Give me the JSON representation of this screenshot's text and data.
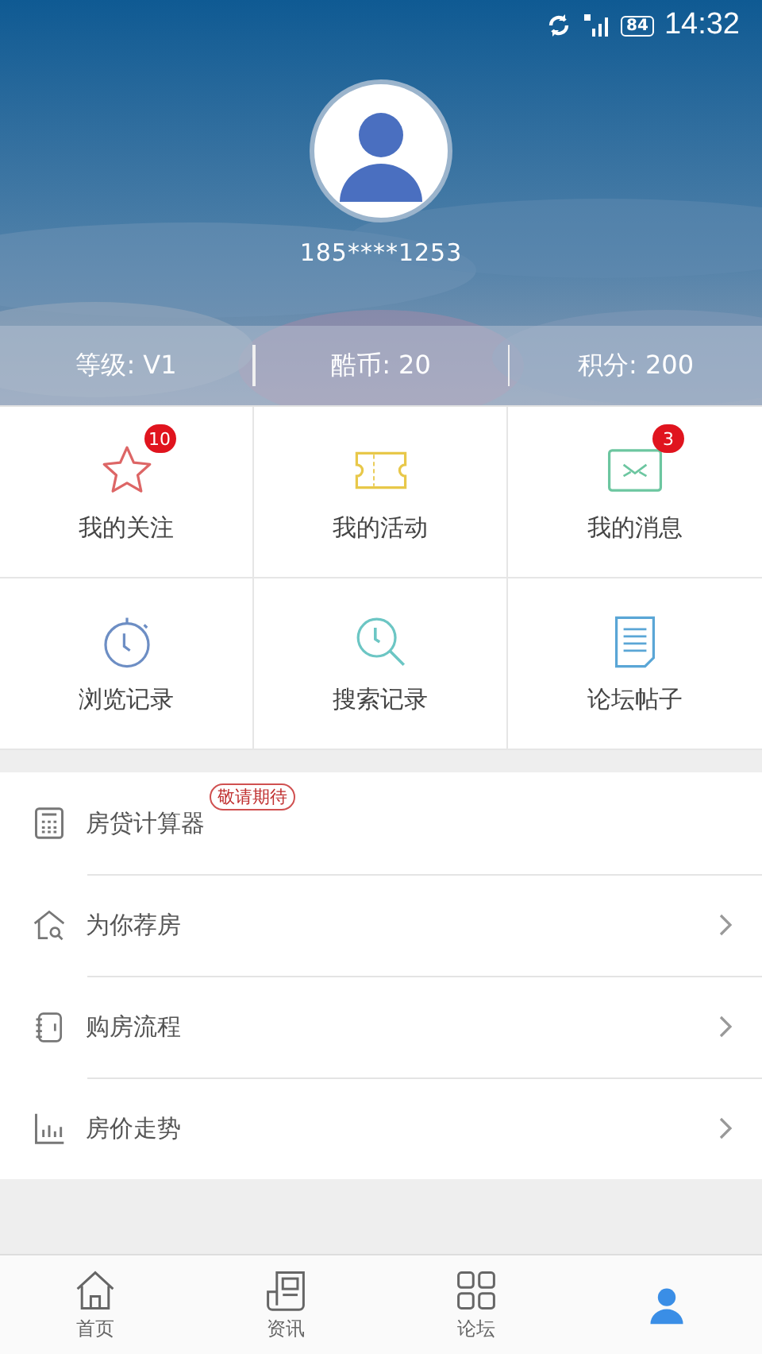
{
  "status_bar": {
    "time": "14:32",
    "battery": "84"
  },
  "profile": {
    "phone": "185****1253"
  },
  "stats": [
    {
      "text": "等级: V1"
    },
    {
      "text": "酷币: 20"
    },
    {
      "text": "积分: 200"
    }
  ],
  "grid": [
    {
      "label": "我的关注",
      "badge": "10"
    },
    {
      "label": "我的活动"
    },
    {
      "label": "我的消息",
      "badge": "3"
    },
    {
      "label": "浏览记录"
    },
    {
      "label": "搜索记录"
    },
    {
      "label": "论坛帖子"
    }
  ],
  "menu": [
    {
      "label": "房贷计算器",
      "tag": "敬请期待",
      "chevron": false
    },
    {
      "label": "为你荐房",
      "chevron": true
    },
    {
      "label": "购房流程",
      "chevron": true
    },
    {
      "label": "房价走势",
      "chevron": true
    }
  ],
  "tabs": [
    {
      "label": "首页",
      "selected": false
    },
    {
      "label": "资讯",
      "selected": false
    },
    {
      "label": "论坛",
      "selected": false
    },
    {
      "selected": true
    }
  ]
}
